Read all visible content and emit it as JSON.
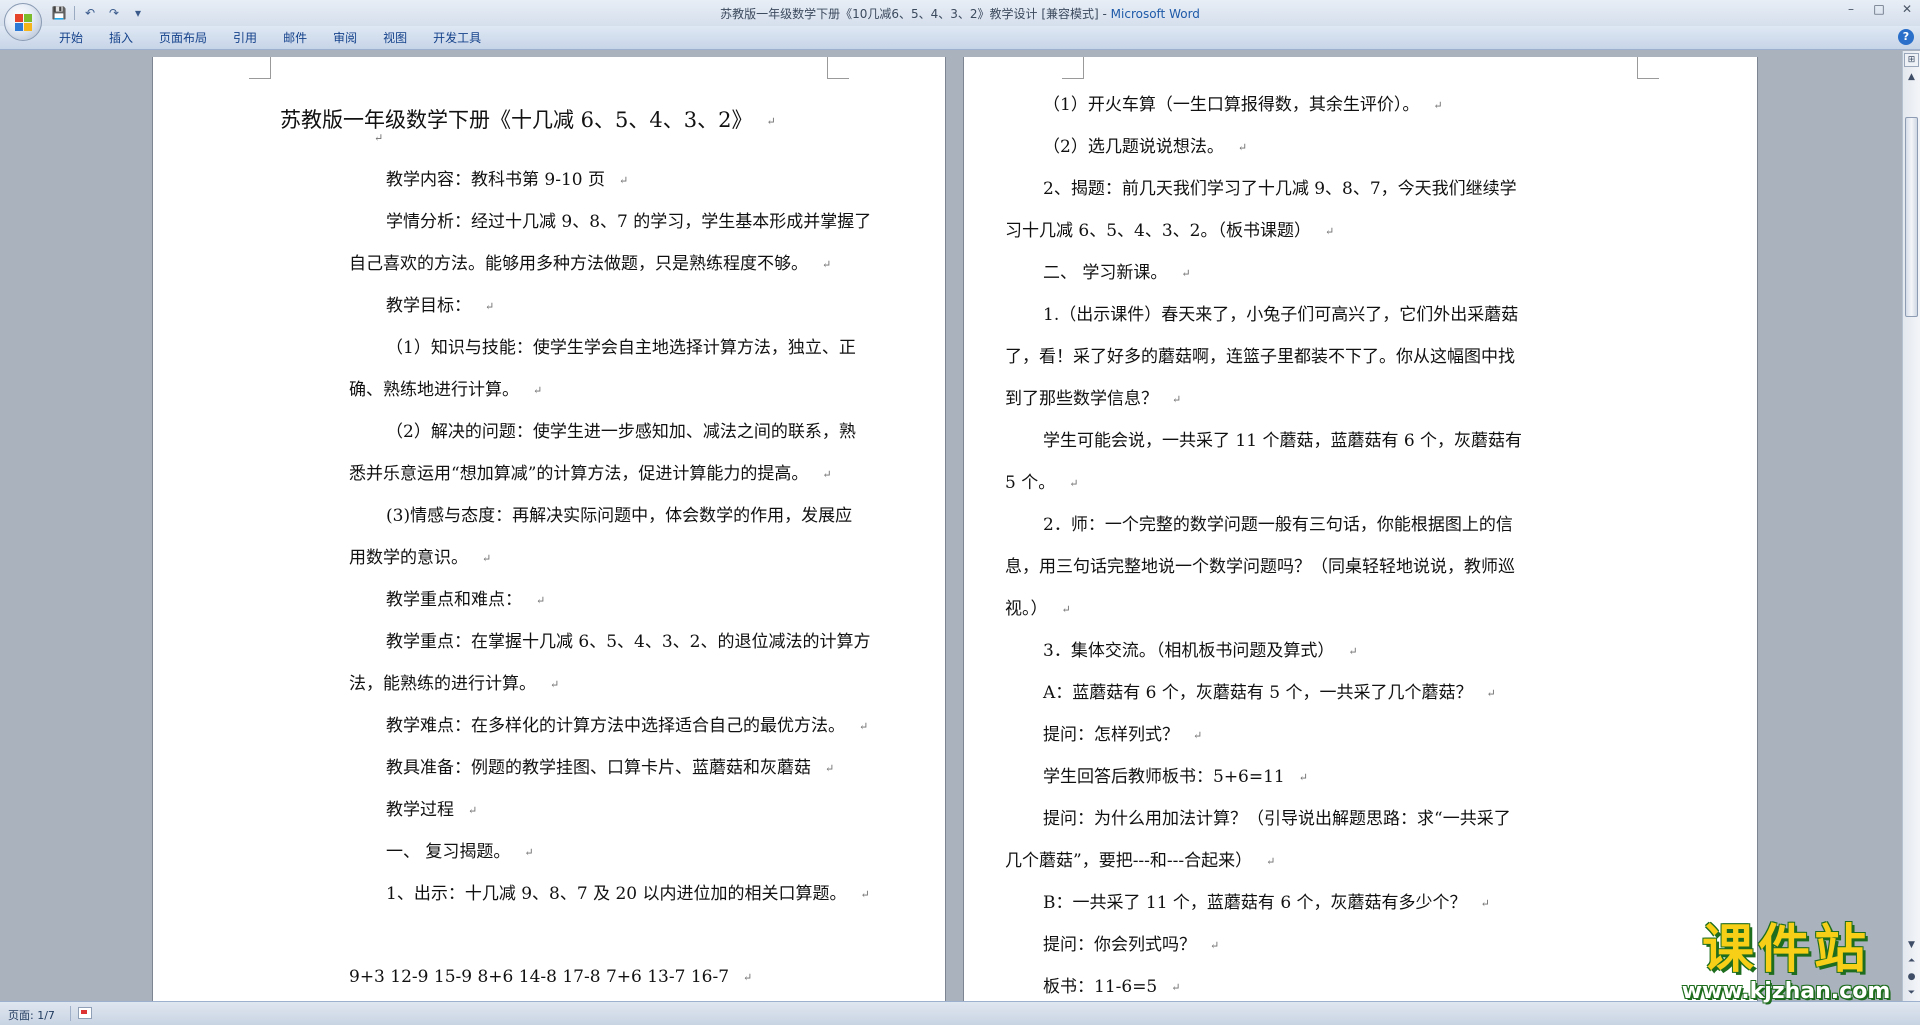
{
  "window": {
    "title_doc": "苏教版一年级数学下册《10几减6、5、4、3、2》教学设计 [兼容模式] - ",
    "title_app": "Microsoft Word",
    "minimize": "–",
    "maximize": "□",
    "close": "✕"
  },
  "quick_access": {
    "save": "💾",
    "undo": "↶",
    "redo": "↷",
    "more": "▾"
  },
  "ribbon": {
    "tabs": [
      "开始",
      "插入",
      "页面布局",
      "引用",
      "邮件",
      "审阅",
      "视图",
      "开发工具"
    ],
    "help": "?"
  },
  "page1": {
    "lines": [
      "苏教版一年级数学下册《十几减 6、5、4、3、2》",
      "",
      "教学内容：教科书第 9-10 页",
      "学情分析：经过十几减 9、8、7 的学习，学生基本形成并掌握了",
      "自己喜欢的方法。能够用多种方法做题，只是熟练程度不够。",
      "教学目标：",
      "（1）知识与技能：使学生学会自主地选择计算方法，独立、正",
      "确、熟练地进行计算。",
      "（2）解决的问题：使学生进一步感知加、减法之间的联系，熟",
      "悉并乐意运用“想加算减”的计算方法，促进计算能力的提高。",
      "(3)情感与态度：再解决实际问题中，体会数学的作用，发展应",
      "用数学的意识。",
      "教学重点和难点：",
      "教学重点：在掌握十几减 6、5、4、3、2、的退位减法的计算方",
      "法，能熟练的进行计算。",
      "教学难点：在多样化的计算方法中选择适合自己的最优方法。",
      "教具准备：例题的教学挂图、口算卡片、蓝蘑菇和灰蘑菇",
      "教学过程",
      "一、    复习揭题。",
      "1、出示：十几减 9、8、7 及 20 以内进位加的相关口算题。",
      "9+3    12-9    15-9    8+6    14-8    17-8    7+6    13-7    16-7"
    ]
  },
  "page2": {
    "lines": [
      "（1）开火车算（一生口算报得数，其余生评价）。",
      "（2）选几题说说想法。",
      "2、揭题：前几天我们学习了十几减 9、8、7，今天我们继续学",
      "习十几减 6、5、4、3、2。（板书课题）",
      "二、    学习新课。",
      "1.（出示课件）春天来了，小兔子们可高兴了，它们外出采蘑菇",
      "了，看！采了好多的蘑菇啊，连篮子里都装不下了。你从这幅图中找",
      "到了那些数学信息？",
      "学生可能会说，一共采了 11 个蘑菇，蓝蘑菇有 6 个，灰蘑菇有",
      "5 个。",
      "2．师：一个完整的数学问题一般有三句话，你能根据图上的信",
      "息，用三句话完整地说一个数学问题吗？（同桌轻轻地说说，教师巡",
      "视。）",
      "3．集体交流。（相机板书问题及算式）",
      "A：蓝蘑菇有 6 个，灰蘑菇有 5 个，一共采了几个蘑菇？",
      "提问：怎样列式？",
      "学生回答后教师板书：5+6=11",
      "提问：为什么用加法计算？（引导说出解题思路：求“一共采了",
      "几个蘑菇”，要把---和---合起来）",
      "B：一共采了 11 个，蓝蘑菇有 6 个，灰蘑菇有多少个？",
      "提问：你会列式吗？",
      "板书：11-6=5"
    ]
  },
  "paragraph_mark": "↵",
  "statusbar": {
    "page": "页面: 1/7"
  },
  "watermark": {
    "big": "课件站",
    "url": "www.kjzhan.com"
  }
}
